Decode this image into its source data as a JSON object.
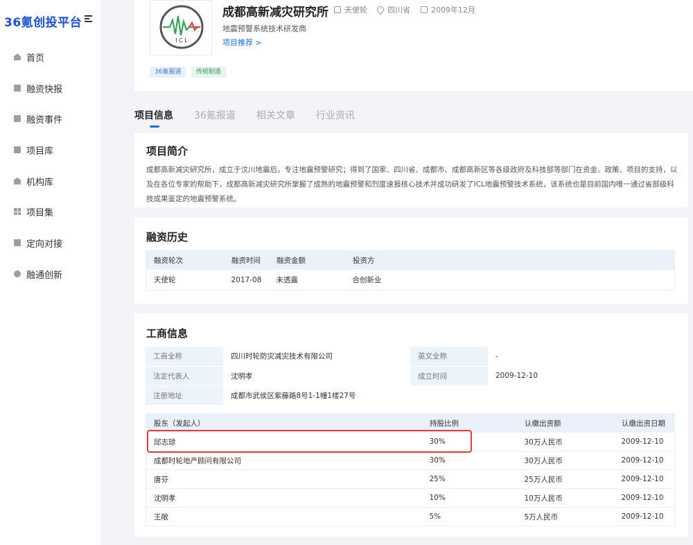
{
  "brand": {
    "name": "36氪创投平台"
  },
  "sidebar": {
    "items": [
      {
        "label": "首页",
        "icon": "home-icon"
      },
      {
        "label": "融资快报",
        "icon": "doc-icon"
      },
      {
        "label": "融资事件",
        "icon": "folder-icon"
      },
      {
        "label": "项目库",
        "icon": "doc-icon"
      },
      {
        "label": "机构库",
        "icon": "bank-icon"
      },
      {
        "label": "项目集",
        "icon": "grid-icon"
      },
      {
        "label": "定向对接",
        "icon": "doc-icon"
      },
      {
        "label": "融通创新",
        "icon": "circle-icon"
      }
    ]
  },
  "company": {
    "name": "成都高新减灾研究所",
    "round": "天使轮",
    "location": "四川省",
    "founded": "2009年12月",
    "description": "地震预警系统技术研发商",
    "recommend_link": "项目推荐 >",
    "tags": [
      "36氪报道",
      "传统制造"
    ],
    "logo_text": "I C L"
  },
  "tabs": [
    "项目信息",
    "36氪报道",
    "相关文章",
    "行业资讯"
  ],
  "intro": {
    "title": "项目简介",
    "text": "成都高新减灾研究所，成立于汶川地震后，专注地震预警研究；得到了国家、四川省、成都市、成都高新区等各级政府及科技部等部门在资金、政策、项目的支持，以及在各位专家的帮助下，成都高新减灾研究所掌握了成熟的地震预警和烈度速报核心技术并成功研发了ICL地震预警技术系统，该系统也是目前国内唯一通过省部级科技成果鉴定的地震预警系统。"
  },
  "financing": {
    "title": "融资历史",
    "headers": [
      "融资轮次",
      "融资时间",
      "融资金额",
      "投资方"
    ],
    "rows": [
      [
        "天使轮",
        "2017-08",
        "未透露",
        "合创新业"
      ]
    ]
  },
  "business": {
    "title": "工商信息",
    "info": [
      {
        "k1": "工商全称",
        "v1": "四川时轮防灾减灾技术有限公司",
        "k2": "英文全称",
        "v2": "-"
      },
      {
        "k1": "法定代表人",
        "v1": "沈明孝",
        "k2": "成立时间",
        "v2": "2009-12-10"
      },
      {
        "k1": "注册地址",
        "v1": "成都市武侯区紫藤路8号1-1幢1楼27号",
        "k2": "",
        "v2": ""
      }
    ],
    "share_headers": [
      "股东（发起人）",
      "持股比例",
      "认缴出资额",
      "认缴出资日期"
    ],
    "shareholders": [
      [
        "邱志琼",
        "30%",
        "30万人民币",
        "2009-12-10"
      ],
      [
        "成都时轮地产顾问有限公司",
        "30%",
        "30万人民币",
        "2009-12-10"
      ],
      [
        "唐芬",
        "25%",
        "25万人民币",
        "2009-12-10"
      ],
      [
        "沈明孝",
        "10%",
        "10万人民币",
        "2009-12-10"
      ],
      [
        "王敞",
        "5%",
        "5万人民币",
        "2009-12-10"
      ]
    ]
  },
  "colors": {
    "accent": "#1a6fe0",
    "highlight": "#e53935",
    "brand": "#1a4fd8"
  }
}
